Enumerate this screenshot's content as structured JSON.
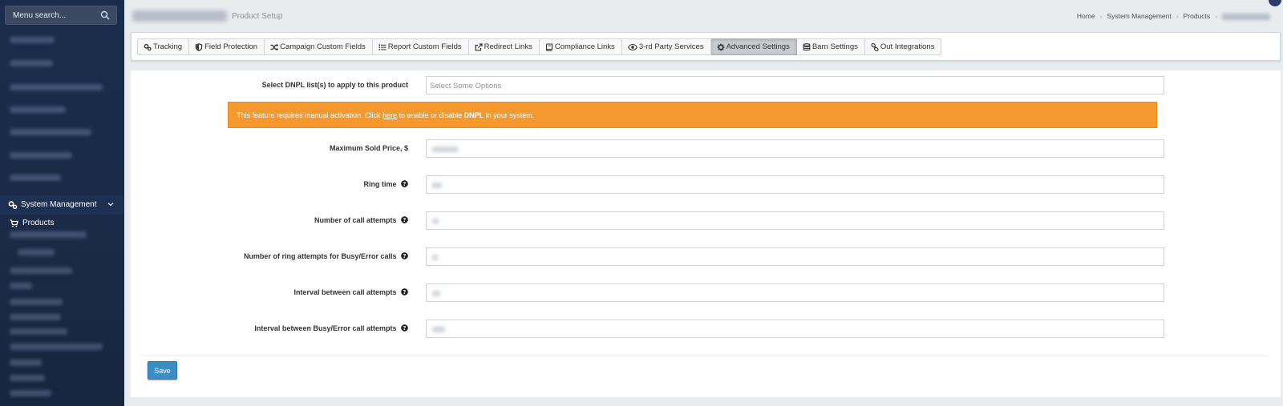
{
  "sidebar": {
    "search_placeholder": "Menu search...",
    "active_section": "System Management",
    "active_item": "Products"
  },
  "header": {
    "subtitle": "Product Setup",
    "breadcrumb": [
      "Home",
      "System Management",
      "Products"
    ]
  },
  "tabs": [
    {
      "label": "Tracking",
      "icon": "gears-icon"
    },
    {
      "label": "Field Protection",
      "icon": "shield-icon"
    },
    {
      "label": "Campaign Custom Fields",
      "icon": "shuffle-icon"
    },
    {
      "label": "Report Custom Fields",
      "icon": "list-icon"
    },
    {
      "label": "Redirect Links",
      "icon": "external-link-icon"
    },
    {
      "label": "Compliance Links",
      "icon": "book-icon"
    },
    {
      "label": "3-rd Party Services",
      "icon": "eye-icon"
    },
    {
      "label": "Advanced Settings",
      "icon": "gear-icon",
      "active": true
    },
    {
      "label": "Barn Settings",
      "icon": "database-icon"
    },
    {
      "label": "Out Integrations",
      "icon": "link-icon"
    }
  ],
  "form": {
    "dnpl_label": "Select DNPL list(s) to apply to this product",
    "dnpl_placeholder": "Select Some Options",
    "alert": {
      "text_before": "This feature requires manual activation. Click",
      "link": "here",
      "text_middle": "to enable or disable",
      "bold": "DNPL",
      "text_after": "in your system."
    },
    "max_price_label": "Maximum Sold Price, $",
    "ring_time_label": "Ring time",
    "call_attempts_label": "Number of call attempts",
    "ring_attempts_busy_label": "Number of ring attempts for Busy/Error calls",
    "interval_label": "Interval between call attempts",
    "interval_busy_label": "Interval between Busy/Error call attempts"
  },
  "save_label": "Save",
  "colors": {
    "sidebar_bg": "#1b2c4c",
    "alert_bg": "#f5992f",
    "save_button": "#3a8ec3",
    "active_tab": "#c7cace"
  }
}
